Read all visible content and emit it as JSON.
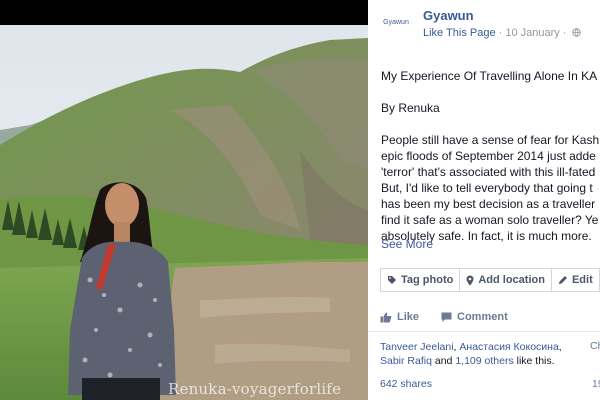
{
  "photo": {
    "watermark": "Renuka-voyagerforlife"
  },
  "page": {
    "logo_text": "Gyawun",
    "name": "Gyawun",
    "like_label": "Like This Page",
    "separator": "·",
    "date": "10 January",
    "date_separator": "·"
  },
  "post": {
    "title": "My Experience Of Travelling Alone In KA",
    "author": "By Renuka",
    "lines": [
      "People still have a sense of fear for Kash",
      "epic floods of September 2014 just adde",
      "'terror' that's associated with this ill-fated",
      "But, I'd like to tell everybody that going t",
      "has been my best decision as a traveller",
      "find it safe as a woman solo traveller? Ye",
      "absolutely safe. In fact, it is much more."
    ],
    "see_more": "See More"
  },
  "tag_bar": {
    "tag_photo": "Tag photo",
    "add_location": "Add location",
    "edit": "Edit"
  },
  "actions": {
    "like": "Like",
    "comment": "Comment"
  },
  "likes": {
    "names": [
      "Tanveer Jeelani",
      "Анастасия Кокосина",
      "Sabir Rafiq"
    ],
    "sep1": ", ",
    "sep2": ",",
    "and": " and ",
    "others": "1,109 others",
    "suffix": " like this.",
    "cut_text": "Ch"
  },
  "shares": {
    "count": "642 shares",
    "cut_text": "19"
  },
  "colors": {
    "link": "#3b5998",
    "meta": "#9197a3",
    "border": "#d3d6db"
  }
}
